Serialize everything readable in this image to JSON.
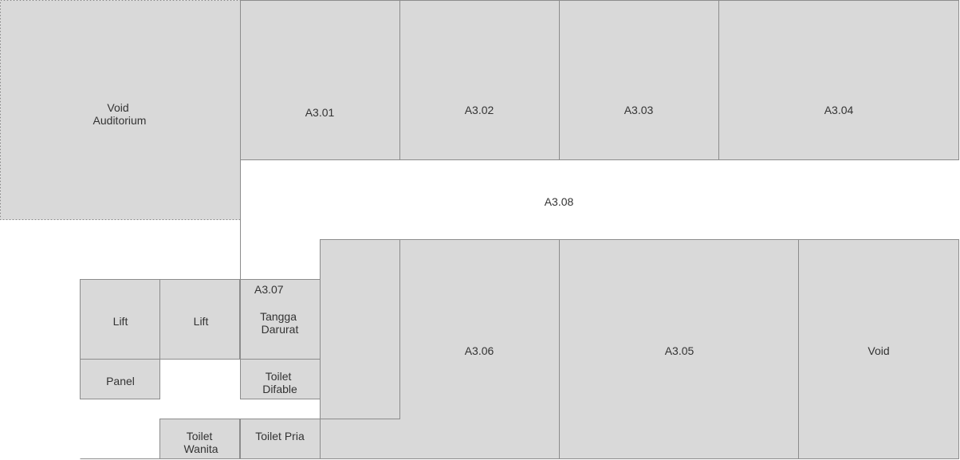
{
  "rooms": {
    "void_auditorium": [
      "Void",
      "Auditorium"
    ],
    "a3_01": "A3.01",
    "a3_02": "A3.02",
    "a3_03": "A3.03",
    "a3_04": "A3.04",
    "a3_08": "A3.08",
    "a3_07": "A3.07",
    "lift_1": "Lift",
    "lift_2": "Lift",
    "tangga_darurat": [
      "Tangga",
      "Darurat"
    ],
    "panel": "Panel",
    "toilet_difable": [
      "Toilet",
      "Difable"
    ],
    "toilet_wanita": [
      "Toilet",
      "Wanita"
    ],
    "toilet_pria": "Toilet Pria",
    "a3_06": "A3.06",
    "a3_05": "A3.05",
    "void": "Void"
  }
}
